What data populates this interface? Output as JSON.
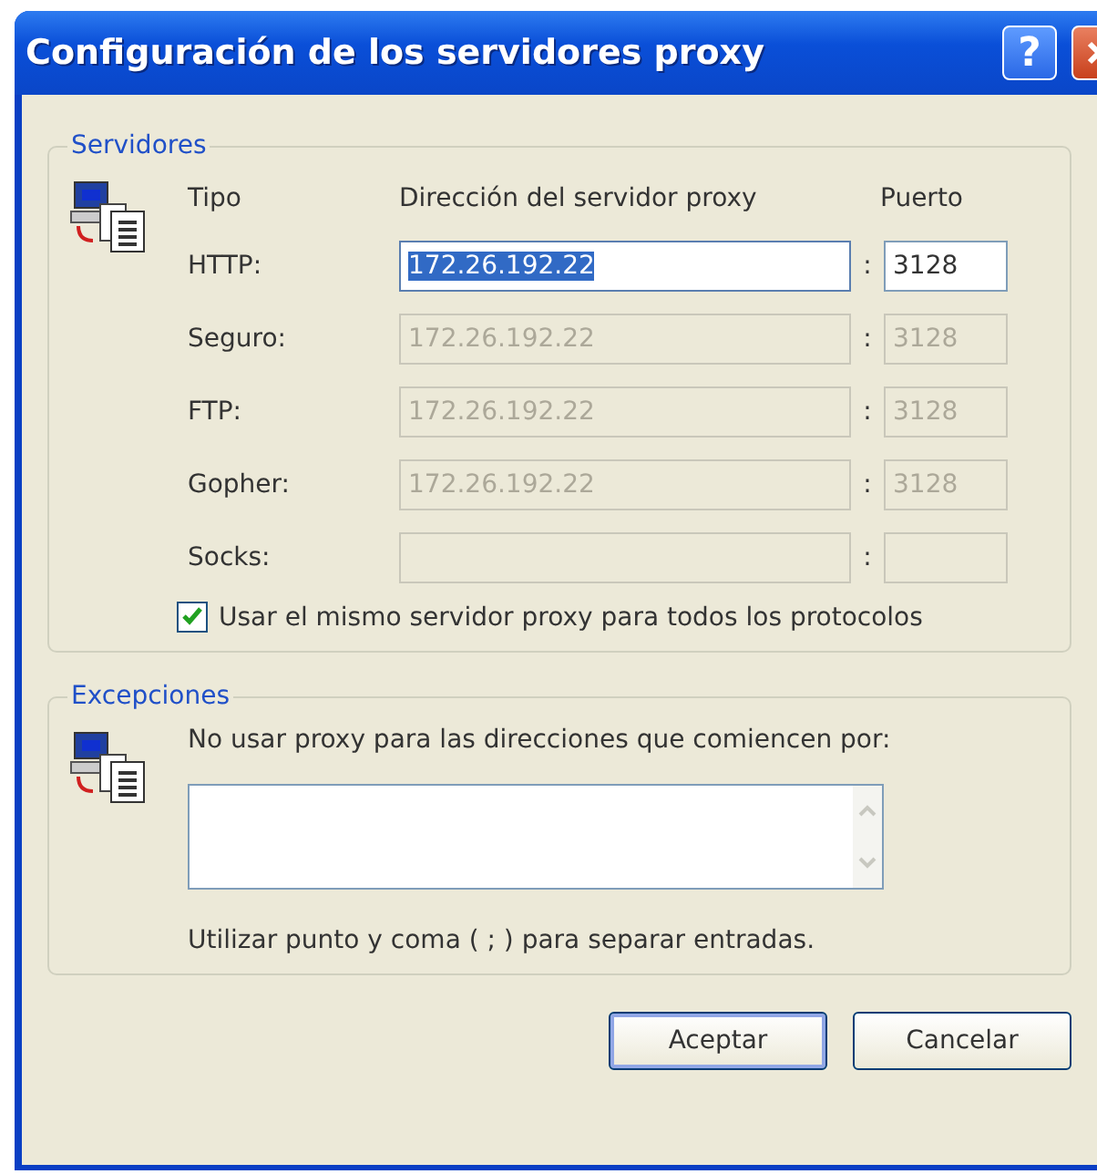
{
  "window": {
    "title": "Configuración de los servidores proxy",
    "help_button": "?"
  },
  "servers": {
    "legend": "Servidores",
    "headers": {
      "type": "Tipo",
      "address": "Dirección del servidor proxy",
      "port": "Puerto"
    },
    "rows": [
      {
        "label": "HTTP:",
        "address": "172.26.192.22",
        "port": "3128",
        "disabled": false,
        "selected": true
      },
      {
        "label": "Seguro:",
        "address": "172.26.192.22",
        "port": "3128",
        "disabled": true,
        "selected": false
      },
      {
        "label": "FTP:",
        "address": "172.26.192.22",
        "port": "3128",
        "disabled": true,
        "selected": false
      },
      {
        "label": "Gopher:",
        "address": "172.26.192.22",
        "port": "3128",
        "disabled": true,
        "selected": false
      },
      {
        "label": "Socks:",
        "disabled": true,
        "selected": false
      }
    ],
    "separator": ":",
    "same_proxy": {
      "label": "Usar el mismo servidor proxy para todos los protocolos",
      "checked": true
    }
  },
  "exceptions": {
    "legend": "Excepciones",
    "prompt": "No usar proxy para las direcciones que comiencen por:",
    "hint": "Utilizar punto y coma ( ; ) para separar entradas."
  },
  "buttons": [
    {
      "label": "Aceptar",
      "default": true
    },
    {
      "label": "Cancelar",
      "default": false
    }
  ]
}
